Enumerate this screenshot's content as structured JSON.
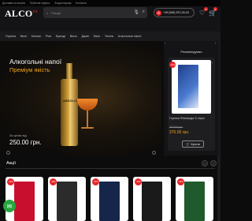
{
  "topbar": {
    "links": [
      "Доставка та оплата",
      "Публічна оферта",
      "Згода покупця",
      "Контакти"
    ]
  },
  "header": {
    "logo": "ALCO",
    "logo_suffix": "UA",
    "search_placeholder": "Пошук",
    "phone": "+38 (068) 870-26-00",
    "cart_count": "0",
    "wishlist_count": "0",
    "icons": [
      "search-icon",
      "microphone-icon",
      "phone-icon",
      "heart-icon",
      "cart-icon"
    ]
  },
  "nav": {
    "items": [
      "Горілка",
      "Віскі",
      "Коньяк",
      "Ром",
      "Бренді",
      "Вино",
      "Джин",
      "Віскі",
      "Текіла",
      "Алкогольні напої"
    ]
  },
  "hero": {
    "title": "Алкогольні напої",
    "subtitle": "Преміум якість",
    "price_label": "За ціною від",
    "price": "250.00 грн.",
    "bottle_label": "ABSOLUT"
  },
  "recommend": {
    "title": "Рекомендуємо",
    "product_name": "Горілка Фінляндія 3 літри",
    "old_price": "415.00 грн.",
    "new_price": "375.00 грн.",
    "button": "Купити",
    "badge": "-10%"
  },
  "akcii": {
    "title": "Акції",
    "products": [
      {
        "badge": "-10%",
        "color": "#c8102e"
      },
      {
        "badge": "-10%",
        "color": "#2b2b2b"
      },
      {
        "badge": "-10%",
        "color": "#16264a"
      },
      {
        "badge": "-10%",
        "color": "#1a1a1a"
      },
      {
        "badge": "-10%",
        "color": "#1f5a2c"
      }
    ]
  },
  "colors": {
    "accent": "#e6252a",
    "price": "#f2a319",
    "background": "#0c0c0d"
  }
}
